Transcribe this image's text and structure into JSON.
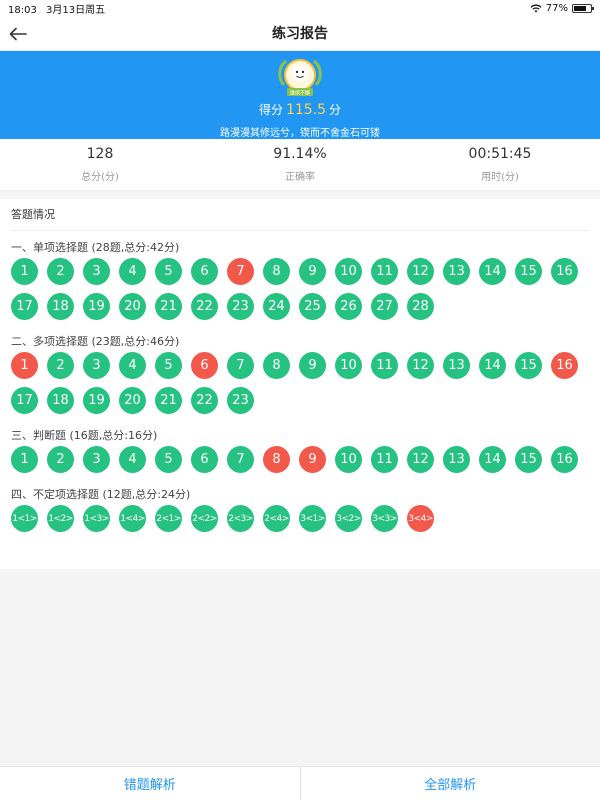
{
  "status": {
    "time": "18:03",
    "date": "3月13日周五",
    "battery": "77%",
    "battery_level": 0.77
  },
  "nav": {
    "title": "练习报告"
  },
  "banner": {
    "badge_text": "继续不懈",
    "score_label": "得分",
    "score_value": "115.5",
    "score_unit": "分",
    "motto": "路漫漫其修远兮，锲而不舍金石可镂"
  },
  "stats": [
    {
      "value": "128",
      "label": "总分(分)"
    },
    {
      "value": "91.14%",
      "label": "正确率"
    },
    {
      "value": "00:51:45",
      "label": "用时(分)"
    }
  ],
  "answers": {
    "title": "答题情况",
    "sections": [
      {
        "title": "一、单项选择题 (28题,总分:42分)",
        "items": [
          {
            "label": "1",
            "wrong": false
          },
          {
            "label": "2",
            "wrong": false
          },
          {
            "label": "3",
            "wrong": false
          },
          {
            "label": "4",
            "wrong": false
          },
          {
            "label": "5",
            "wrong": false
          },
          {
            "label": "6",
            "wrong": false
          },
          {
            "label": "7",
            "wrong": true
          },
          {
            "label": "8",
            "wrong": false
          },
          {
            "label": "9",
            "wrong": false
          },
          {
            "label": "10",
            "wrong": false
          },
          {
            "label": "11",
            "wrong": false
          },
          {
            "label": "12",
            "wrong": false
          },
          {
            "label": "13",
            "wrong": false
          },
          {
            "label": "14",
            "wrong": false
          },
          {
            "label": "15",
            "wrong": false
          },
          {
            "label": "16",
            "wrong": false
          },
          {
            "label": "17",
            "wrong": false
          },
          {
            "label": "18",
            "wrong": false
          },
          {
            "label": "19",
            "wrong": false
          },
          {
            "label": "20",
            "wrong": false
          },
          {
            "label": "21",
            "wrong": false
          },
          {
            "label": "22",
            "wrong": false
          },
          {
            "label": "23",
            "wrong": false
          },
          {
            "label": "24",
            "wrong": false
          },
          {
            "label": "25",
            "wrong": false
          },
          {
            "label": "26",
            "wrong": false
          },
          {
            "label": "27",
            "wrong": false
          },
          {
            "label": "28",
            "wrong": false
          }
        ]
      },
      {
        "title": "二、多项选择题 (23题,总分:46分)",
        "items": [
          {
            "label": "1",
            "wrong": true
          },
          {
            "label": "2",
            "wrong": false
          },
          {
            "label": "3",
            "wrong": false
          },
          {
            "label": "4",
            "wrong": false
          },
          {
            "label": "5",
            "wrong": false
          },
          {
            "label": "6",
            "wrong": true
          },
          {
            "label": "7",
            "wrong": false
          },
          {
            "label": "8",
            "wrong": false
          },
          {
            "label": "9",
            "wrong": false
          },
          {
            "label": "10",
            "wrong": false
          },
          {
            "label": "11",
            "wrong": false
          },
          {
            "label": "12",
            "wrong": false
          },
          {
            "label": "13",
            "wrong": false
          },
          {
            "label": "14",
            "wrong": false
          },
          {
            "label": "15",
            "wrong": false
          },
          {
            "label": "16",
            "wrong": true
          },
          {
            "label": "17",
            "wrong": false
          },
          {
            "label": "18",
            "wrong": false
          },
          {
            "label": "19",
            "wrong": false
          },
          {
            "label": "20",
            "wrong": false
          },
          {
            "label": "21",
            "wrong": false
          },
          {
            "label": "22",
            "wrong": false
          },
          {
            "label": "23",
            "wrong": false
          }
        ]
      },
      {
        "title": "三、判断题 (16题,总分:16分)",
        "items": [
          {
            "label": "1",
            "wrong": false
          },
          {
            "label": "2",
            "wrong": false
          },
          {
            "label": "3",
            "wrong": false
          },
          {
            "label": "4",
            "wrong": false
          },
          {
            "label": "5",
            "wrong": false
          },
          {
            "label": "6",
            "wrong": false
          },
          {
            "label": "7",
            "wrong": false
          },
          {
            "label": "8",
            "wrong": true
          },
          {
            "label": "9",
            "wrong": true
          },
          {
            "label": "10",
            "wrong": false
          },
          {
            "label": "11",
            "wrong": false
          },
          {
            "label": "12",
            "wrong": false
          },
          {
            "label": "13",
            "wrong": false
          },
          {
            "label": "14",
            "wrong": false
          },
          {
            "label": "15",
            "wrong": false
          },
          {
            "label": "16",
            "wrong": false
          }
        ]
      },
      {
        "title": "四、不定项选择题 (12题,总分:24分)",
        "small": true,
        "items": [
          {
            "label": "1<1>",
            "wrong": false
          },
          {
            "label": "1<2>",
            "wrong": false
          },
          {
            "label": "1<3>",
            "wrong": false
          },
          {
            "label": "1<4>",
            "wrong": false
          },
          {
            "label": "2<1>",
            "wrong": false
          },
          {
            "label": "2<2>",
            "wrong": false
          },
          {
            "label": "2<3>",
            "wrong": false
          },
          {
            "label": "2<4>",
            "wrong": false
          },
          {
            "label": "3<1>",
            "wrong": false
          },
          {
            "label": "3<2>",
            "wrong": false
          },
          {
            "label": "3<3>",
            "wrong": false
          },
          {
            "label": "3<4>",
            "wrong": true
          }
        ]
      }
    ]
  },
  "bottom": {
    "wrong_analysis": "错题解析",
    "all_analysis": "全部解析"
  },
  "colors": {
    "primary": "#2196f3",
    "correct": "#26c281",
    "wrong": "#f2594b",
    "score": "#ffd54f"
  }
}
